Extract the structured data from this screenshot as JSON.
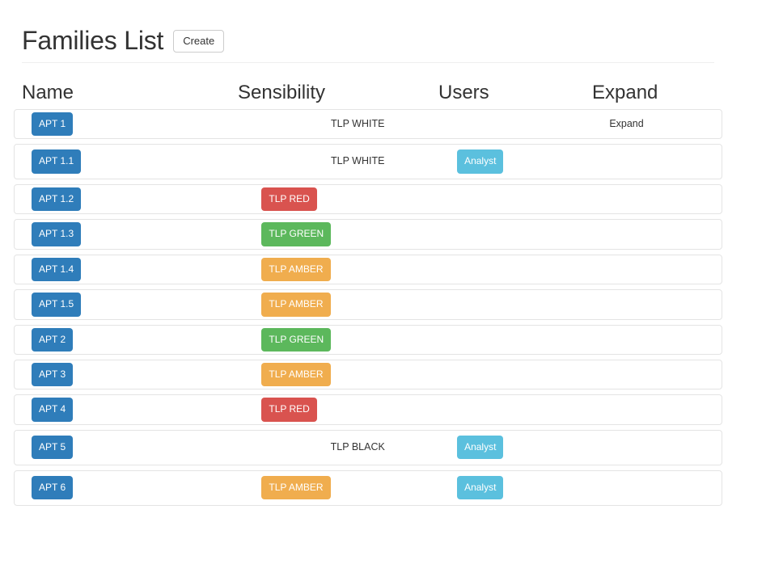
{
  "header": {
    "title": "Families List",
    "create_label": "Create"
  },
  "table": {
    "columns": [
      "Name",
      "Sensibility",
      "Users",
      "Expand"
    ],
    "rows": [
      {
        "name": "APT 1",
        "sensibility": "TLP WHITE",
        "sensibility_style": "plain",
        "users": "",
        "users_style": "none",
        "expand": "Expand"
      },
      {
        "name": "APT 1.1",
        "sensibility": "TLP WHITE",
        "sensibility_style": "plain",
        "users": "Analyst",
        "users_style": "info",
        "expand": ""
      },
      {
        "name": "APT 1.2",
        "sensibility": "TLP RED",
        "sensibility_style": "red",
        "users": "",
        "users_style": "none",
        "expand": ""
      },
      {
        "name": "APT 1.3",
        "sensibility": "TLP GREEN",
        "sensibility_style": "green",
        "users": "",
        "users_style": "none",
        "expand": ""
      },
      {
        "name": "APT 1.4",
        "sensibility": "TLP AMBER",
        "sensibility_style": "amber",
        "users": "",
        "users_style": "none",
        "expand": ""
      },
      {
        "name": "APT 1.5",
        "sensibility": "TLP AMBER",
        "sensibility_style": "amber",
        "users": "",
        "users_style": "none",
        "expand": ""
      },
      {
        "name": "APT 2",
        "sensibility": "TLP GREEN",
        "sensibility_style": "green",
        "users": "",
        "users_style": "none",
        "expand": ""
      },
      {
        "name": "APT 3",
        "sensibility": "TLP AMBER",
        "sensibility_style": "amber",
        "users": "",
        "users_style": "none",
        "expand": ""
      },
      {
        "name": "APT 4",
        "sensibility": "TLP RED",
        "sensibility_style": "red",
        "users": "",
        "users_style": "none",
        "expand": ""
      },
      {
        "name": "APT 5",
        "sensibility": "TLP BLACK",
        "sensibility_style": "plain",
        "users": "Analyst",
        "users_style": "info",
        "expand": ""
      },
      {
        "name": "APT 6",
        "sensibility": "TLP AMBER",
        "sensibility_style": "amber",
        "users": "Analyst",
        "users_style": "info",
        "expand": ""
      }
    ]
  },
  "colors": {
    "name_badge": "#2f7dba",
    "tlp_red": "#d9534f",
    "tlp_green": "#5cb85c",
    "tlp_amber": "#f0ad4e",
    "user_badge": "#5bc0de",
    "row_border": "#e4e4e4",
    "divider": "#eeeeee"
  }
}
